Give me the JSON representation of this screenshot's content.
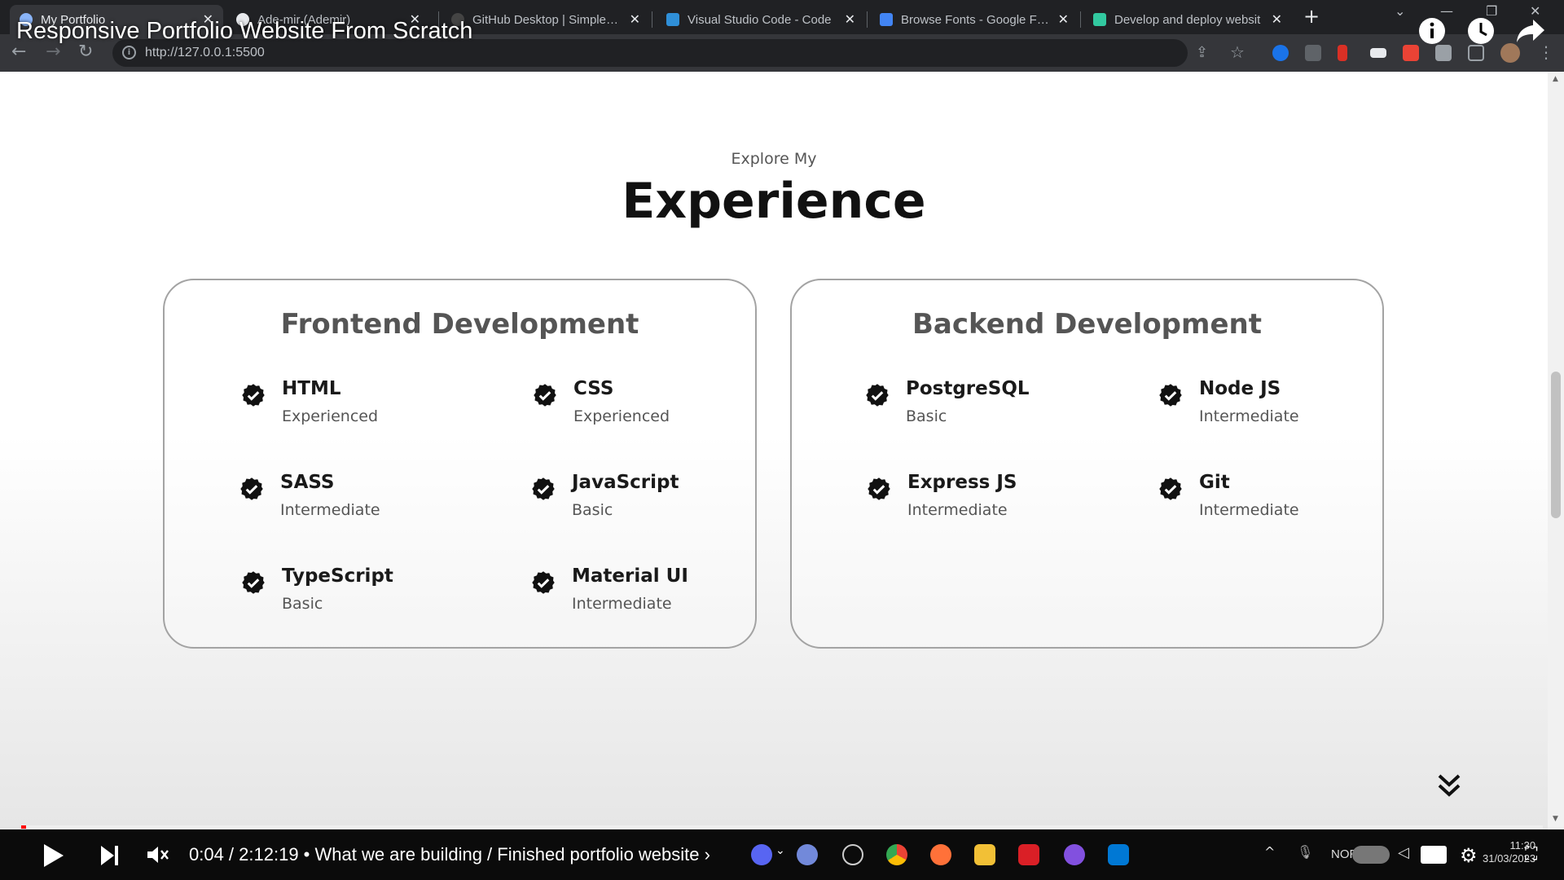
{
  "browser": {
    "tabs": [
      {
        "label": "My Portfolio",
        "active": true,
        "icon": "globe-icon"
      },
      {
        "label": "Ade-mir (Ademir)",
        "active": false,
        "icon": "github-icon"
      },
      {
        "label": "GitHub Desktop | Simple co",
        "active": false,
        "icon": "github-icon"
      },
      {
        "label": "Visual Studio Code - Code",
        "active": false,
        "icon": "vscode-icon"
      },
      {
        "label": "Browse Fonts - Google Fon",
        "active": false,
        "icon": "google-fonts-icon"
      },
      {
        "label": "Develop and deploy websit",
        "active": false,
        "icon": "netlify-icon"
      }
    ],
    "url": "http://127.0.0.1:5500"
  },
  "page": {
    "subtitle": "Explore My",
    "title": "Experience",
    "cards": [
      {
        "title": "Frontend Development",
        "skills": [
          {
            "name": "HTML",
            "level": "Experienced"
          },
          {
            "name": "CSS",
            "level": "Experienced"
          },
          {
            "name": "SASS",
            "level": "Intermediate"
          },
          {
            "name": "JavaScript",
            "level": "Basic"
          },
          {
            "name": "TypeScript",
            "level": "Basic"
          },
          {
            "name": "Material UI",
            "level": "Intermediate"
          }
        ]
      },
      {
        "title": "Backend Development",
        "skills": [
          {
            "name": "PostgreSQL",
            "level": "Basic"
          },
          {
            "name": "Node JS",
            "level": "Intermediate"
          },
          {
            "name": "Express JS",
            "level": "Intermediate"
          },
          {
            "name": "Git",
            "level": "Intermediate"
          }
        ]
      }
    ]
  },
  "video": {
    "title": "Responsive Portfolio Website From Scratch",
    "time": "0:04 / 2:12:19",
    "chapter": " • What we are building / Finished portfolio website ›",
    "progress": 0.0005
  },
  "taskbar": {
    "lang": "NOR",
    "time": "11:30",
    "date": "31/03/2023"
  },
  "colors": {
    "accent": "#ff0000",
    "chrome_dark": "#202124",
    "chrome_tab": "#35363a"
  }
}
